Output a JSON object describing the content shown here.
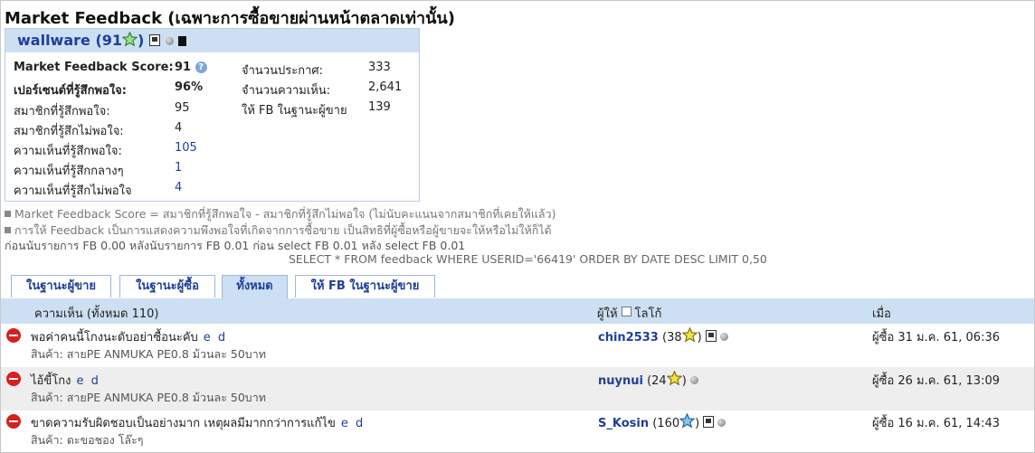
{
  "page_title": "Market Feedback (เฉพาะการซื้อขายผ่านหน้าตลาดเท่านั้น)",
  "user": {
    "name": "wallware",
    "score_text": "(91",
    "close_paren": ")",
    "star_color": "#7fc77a"
  },
  "stats_left": [
    {
      "label": "Market Feedback Score:",
      "value": "91"
    },
    {
      "label": "เปอร์เซนต์ที่รู้สึกพอใจ:",
      "value": "96%"
    },
    {
      "label": "สมาชิกที่รู้สึกพอใจ:",
      "value": "95"
    },
    {
      "label": "สมาชิกที่รู้สึกไม่พอใจ:",
      "value": "4"
    },
    {
      "label": "ความเห็นที่รู้สึกพอใจ:",
      "value": "105"
    },
    {
      "label": "ความเห็นที่รู้สึกกลางๆ",
      "value": "1"
    },
    {
      "label": "ความเห็นที่รู้สึกไม่พอใจ",
      "value": "4"
    }
  ],
  "stats_right": [
    {
      "label": "จำนวนประกาศ:",
      "value": "333"
    },
    {
      "label": "จำนวนความเห็น:",
      "value": "2,641"
    },
    {
      "label": "ให้ FB ในฐานะผู้ขาย",
      "value": "139"
    }
  ],
  "notes": [
    "Market Feedback Score = สมาชิกที่รู้สึกพอใจ - สมาชิกที่รู้สึกไม่พอใจ (ไม่นับคะแนนจากสมาชิกที่เคยให้แล้ว)",
    "การให้ Feedback เป็นการแสดงความพึงพอใจที่เกิดจากการซื้อขาย เป็นสิทธิที่ผู้ซื้อหรือผู้ขายจะให้หรือไม่ให้ก็ได้"
  ],
  "debug_line": "ก่อนนับรายการ FB 0.00 หลังนับรายการ FB 0.01 ก่อน select FB 0.01 หลัง select FB 0.01",
  "sql_line": "SELECT * FROM feedback WHERE USERID='66419' ORDER BY DATE DESC LIMIT 0,50",
  "tabs": [
    {
      "label": "ในฐานะผู้ขาย",
      "active": false
    },
    {
      "label": "ในฐานะผู้ซื้อ",
      "active": false
    },
    {
      "label": "ทั้งหมด",
      "active": true
    },
    {
      "label": "ให้ FB ในฐานะผู้ขาย",
      "active": false
    }
  ],
  "table": {
    "col_comment": "ความเห็น (ทั้งหมด 110)",
    "col_giver": "ผู้ให้",
    "col_logo": "โลโก้",
    "col_when": "เมื่อ",
    "rows": [
      {
        "comment": "พอค่าคนนี้โกงนะดับอย่าซื้อนะคับ",
        "edit": "e d",
        "product": "สินค้า: สายPE ANMUKA PE0.8 ม้วนละ 50บาท",
        "giver": "chin2533",
        "giver_score": "(38",
        "star_color": "#e8d000",
        "giver_close": ")",
        "when": "ผู้ซื้อ 31 ม.ค. 61, 06:36"
      },
      {
        "comment": "ไอ้ขี้โกง",
        "edit": "e d",
        "product": "สินค้า: สายPE ANMUKA PE0.8 ม้วนละ 50บาท",
        "giver": "nuynui",
        "giver_score": "(24",
        "star_color": "#e8d000",
        "giver_close": ")",
        "when": "ผู้ซื้อ 26 ม.ค. 61, 13:09"
      },
      {
        "comment": "ขาดความรับผิดชอบเป็นอย่างมาก เหตุผลมีมากกว่าการแก้ไข",
        "edit": "e d",
        "product": "สินค้า: ตะขอชอง โล๊ะๆ",
        "giver": "S_Kosin",
        "giver_score": "(160",
        "star_color": "#4da6e0",
        "giver_close": ")",
        "when": "ผู้ซื้อ 16 ม.ค. 61, 14:43"
      }
    ]
  }
}
